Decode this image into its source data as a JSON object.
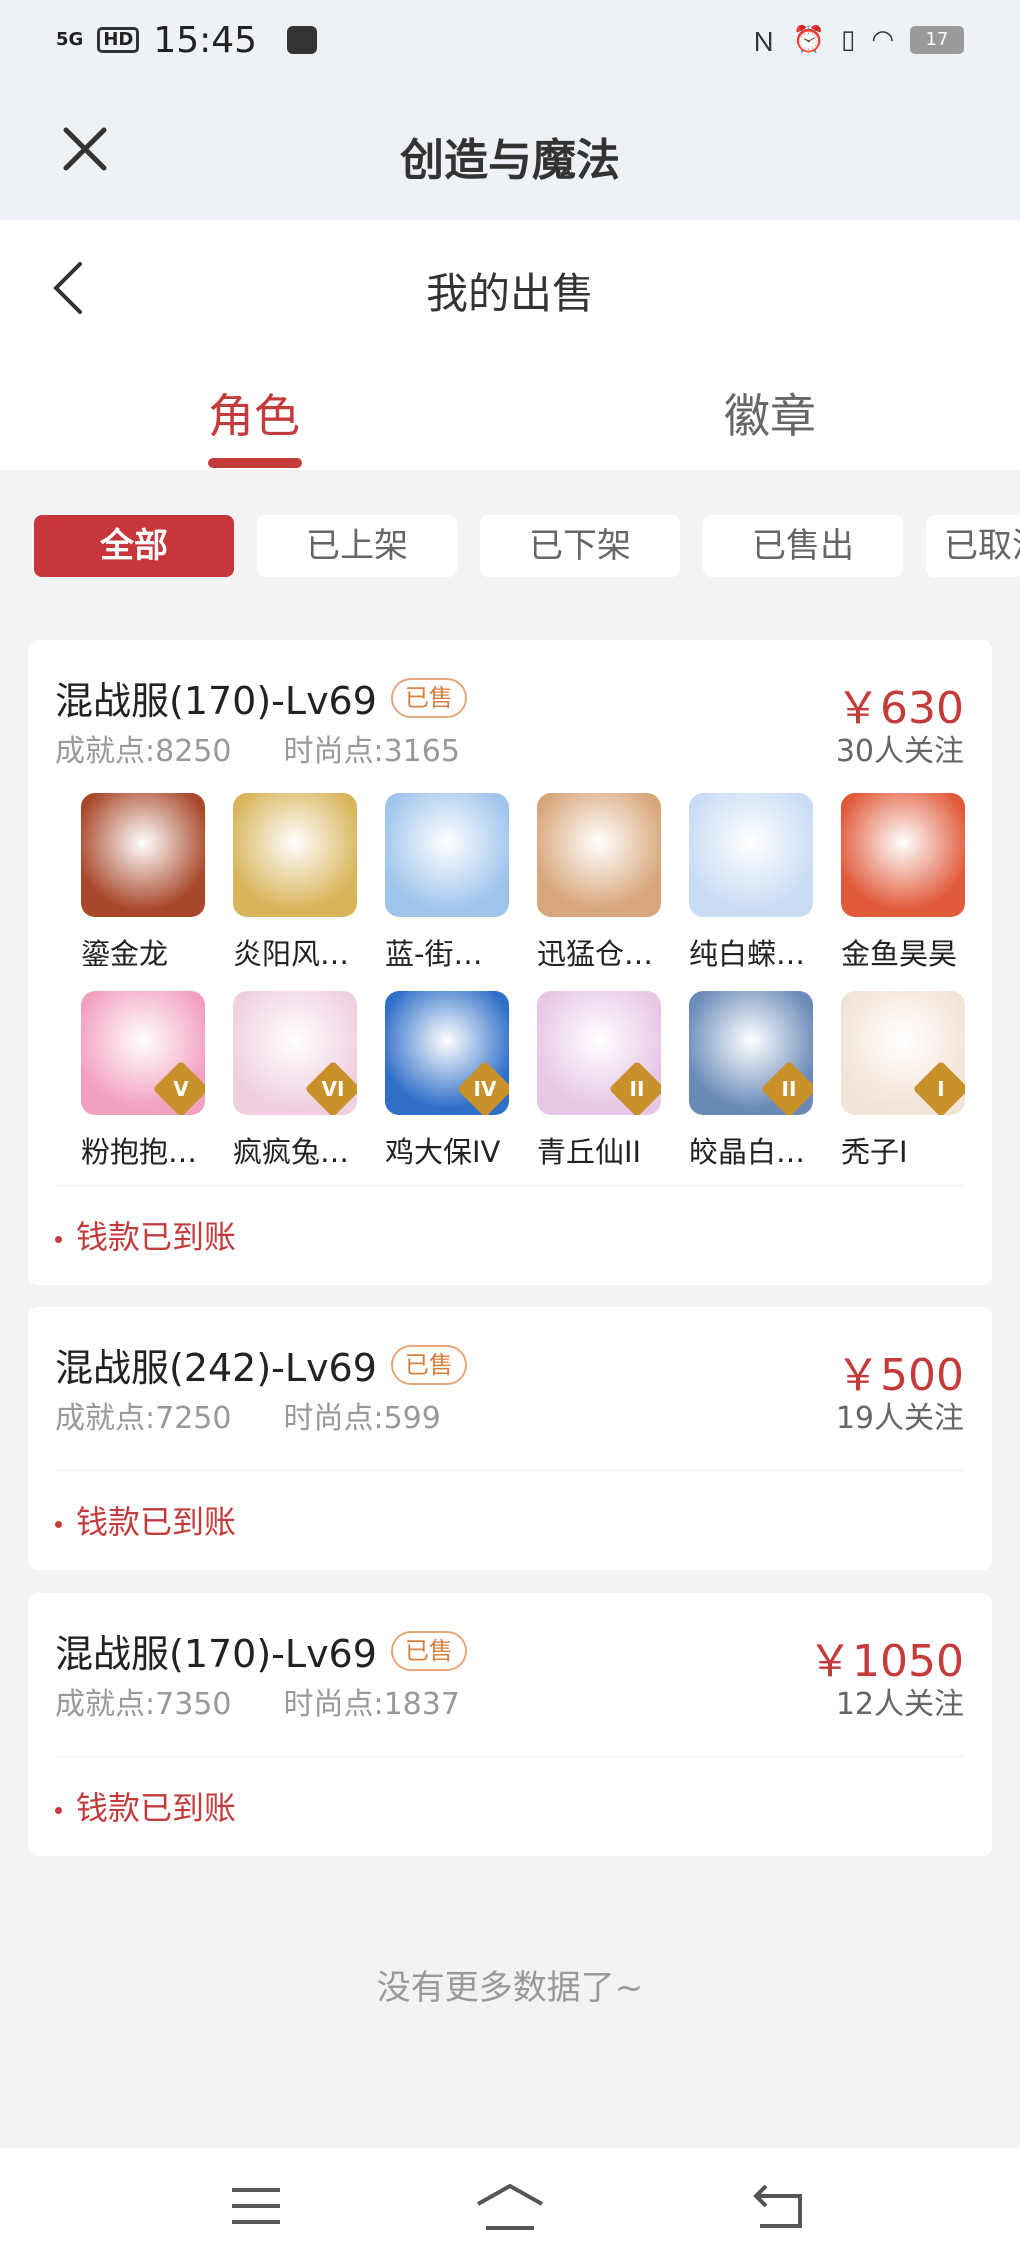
{
  "status": {
    "signal": "5G",
    "hd": "HD",
    "time": "15:45",
    "battery": "17"
  },
  "app": {
    "title": "创造与魔法"
  },
  "page": {
    "title": "我的出售"
  },
  "tabs": [
    {
      "label": "角色",
      "active": true
    },
    {
      "label": "徽章",
      "active": false
    }
  ],
  "filters": [
    "全部",
    "已上架",
    "已下架",
    "已售出",
    "已取消"
  ],
  "orders": [
    {
      "server": "混战服(170)-Lv69",
      "status": "已售",
      "price": "￥630",
      "achievement": "成就点:8250",
      "fashion": "时尚点:3165",
      "followers": "30人关注",
      "payment": "钱款已到账",
      "skins": [
        {
          "name": "鎏金龙",
          "icon": "golden-dragon-icon",
          "color": "#a8482a"
        },
        {
          "name": "炎阳风…",
          "icon": "sun-staff-icon",
          "color": "#d9b45a"
        },
        {
          "name": "蓝-街…",
          "icon": "skateboard-icon",
          "color": "#9fc4ec"
        },
        {
          "name": "迅猛仓…",
          "icon": "hamster-pilot-icon",
          "color": "#d8a67a"
        },
        {
          "name": "纯白蝾…",
          "icon": "white-axolotl-icon",
          "color": "#c9dcf5"
        },
        {
          "name": "金鱼昊昊",
          "icon": "goldfish-icon",
          "color": "#e05a3a"
        },
        {
          "name": "粉抱抱…",
          "icon": "pink-bear-icon",
          "color": "#f2a0c0",
          "tier": "V"
        },
        {
          "name": "疯疯兔…",
          "icon": "crazy-rabbit-icon",
          "color": "#f0d0e0",
          "tier": "VI"
        },
        {
          "name": "鸡大保IV",
          "icon": "blue-chicken-icon",
          "color": "#2f6fc8",
          "tier": "IV"
        },
        {
          "name": "青丘仙II",
          "icon": "fox-fairy-icon",
          "color": "#e7c6e6",
          "tier": "II"
        },
        {
          "name": "皎晶白…",
          "icon": "crystal-tiger-icon",
          "color": "#6a8ab8",
          "tier": "II"
        },
        {
          "name": "秃子I",
          "icon": "bald-boy-icon",
          "color": "#f3e4d8",
          "tier": "I"
        }
      ]
    },
    {
      "server": "混战服(242)-Lv69",
      "status": "已售",
      "price": "￥500",
      "achievement": "成就点:7250",
      "fashion": "时尚点:599",
      "followers": "19人关注",
      "payment": "钱款已到账"
    },
    {
      "server": "混战服(170)-Lv69",
      "status": "已售",
      "price": "￥1050",
      "achievement": "成就点:7350",
      "fashion": "时尚点:1837",
      "followers": "12人关注",
      "payment": "钱款已到账"
    }
  ],
  "footer": {
    "no_more": "没有更多数据了~"
  },
  "colors": {
    "accent": "#c43b3b",
    "badge": "#d9803e"
  }
}
